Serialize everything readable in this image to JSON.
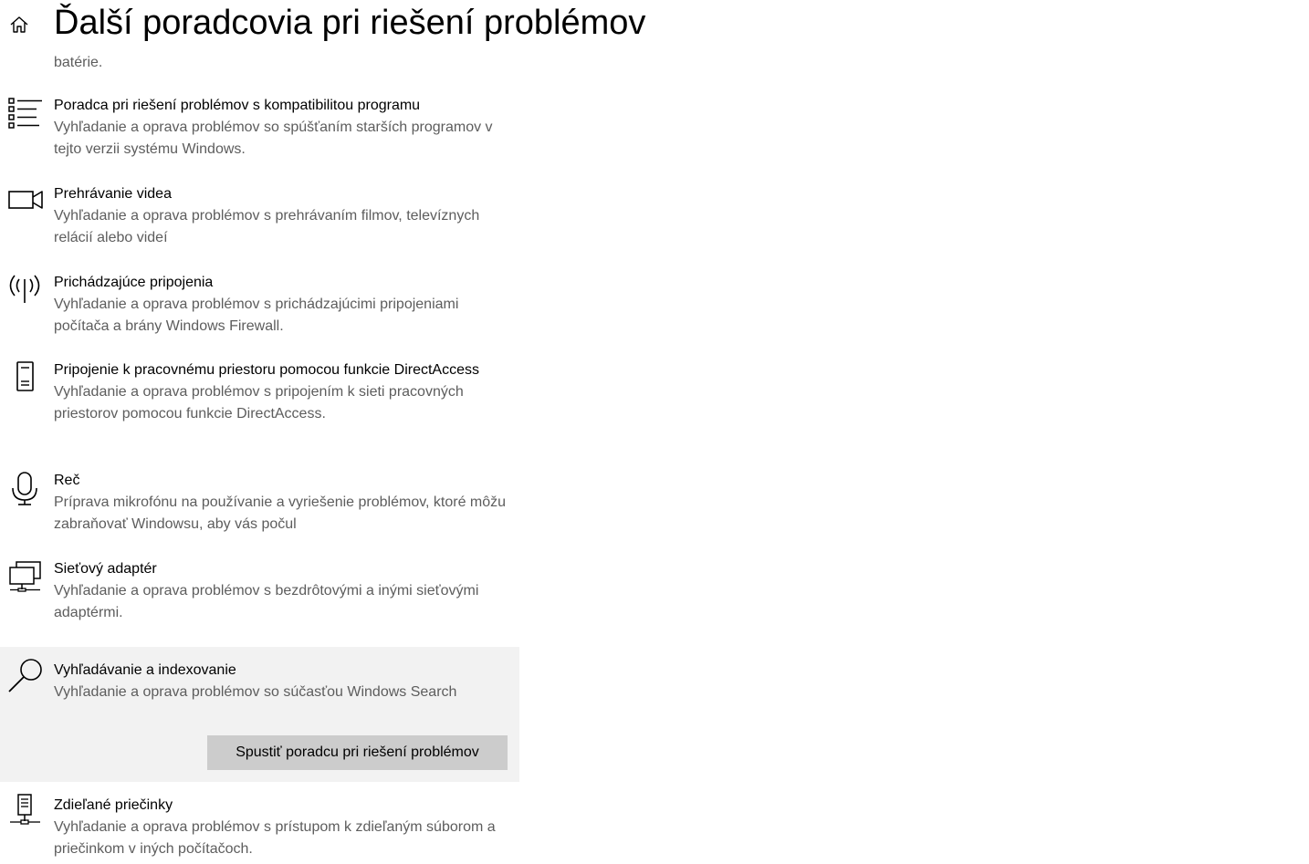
{
  "header": {
    "title": "Ďalší poradcovia pri riešení problémov",
    "home_icon": "home-icon"
  },
  "truncated_description": "batérie.",
  "troubleshooters": [
    {
      "icon": "list-icon",
      "title": "Poradca pri riešení problémov s kompatibilitou programu",
      "description": "Vyhľadanie a oprava problémov so spúšťaním starších programov v tejto verzii systému Windows."
    },
    {
      "icon": "video-camera-icon",
      "title": "Prehrávanie videa",
      "description": "Vyhľadanie a oprava problémov s prehrávaním filmov, televíznych relácií alebo videí"
    },
    {
      "icon": "antenna-icon",
      "title": "Prichádzajúce pripojenia",
      "description": "Vyhľadanie a oprava problémov s prichádzajúcimi pripojeniami počítača a brány Windows Firewall."
    },
    {
      "icon": "phone-icon",
      "title": "Pripojenie k pracovnému priestoru pomocou funkcie DirectAccess",
      "description": "Vyhľadanie a oprava problémov s pripojením k sieti pracovných priestorov pomocou funkcie DirectAccess."
    },
    {
      "icon": "microphone-icon",
      "title": "Reč",
      "description": "Príprava mikrofónu na používanie a vyriešenie problémov, ktoré môžu zabraňovať Windowsu, aby vás počul"
    },
    {
      "icon": "network-adapter-icon",
      "title": "Sieťový adaptér",
      "description": "Vyhľadanie a oprava problémov s bezdrôtovými a inými sieťovými adaptérmi."
    },
    {
      "icon": "search-icon",
      "title": "Vyhľadávanie a indexovanie",
      "description": "Vyhľadanie a oprava problémov so súčasťou Windows Search",
      "selected": true,
      "button_label": "Spustiť poradcu pri riešení problémov"
    },
    {
      "icon": "shared-folder-icon",
      "title": "Zdieľané priečinky",
      "description": "Vyhľadanie a oprava problémov s prístupom k zdieľaným súborom a priečinkom v iných počítačoch."
    }
  ],
  "colors": {
    "title_text": "#000000",
    "description_text": "#5d5d5d",
    "selected_background": "#f2f2f2",
    "button_background": "#cccccc"
  }
}
